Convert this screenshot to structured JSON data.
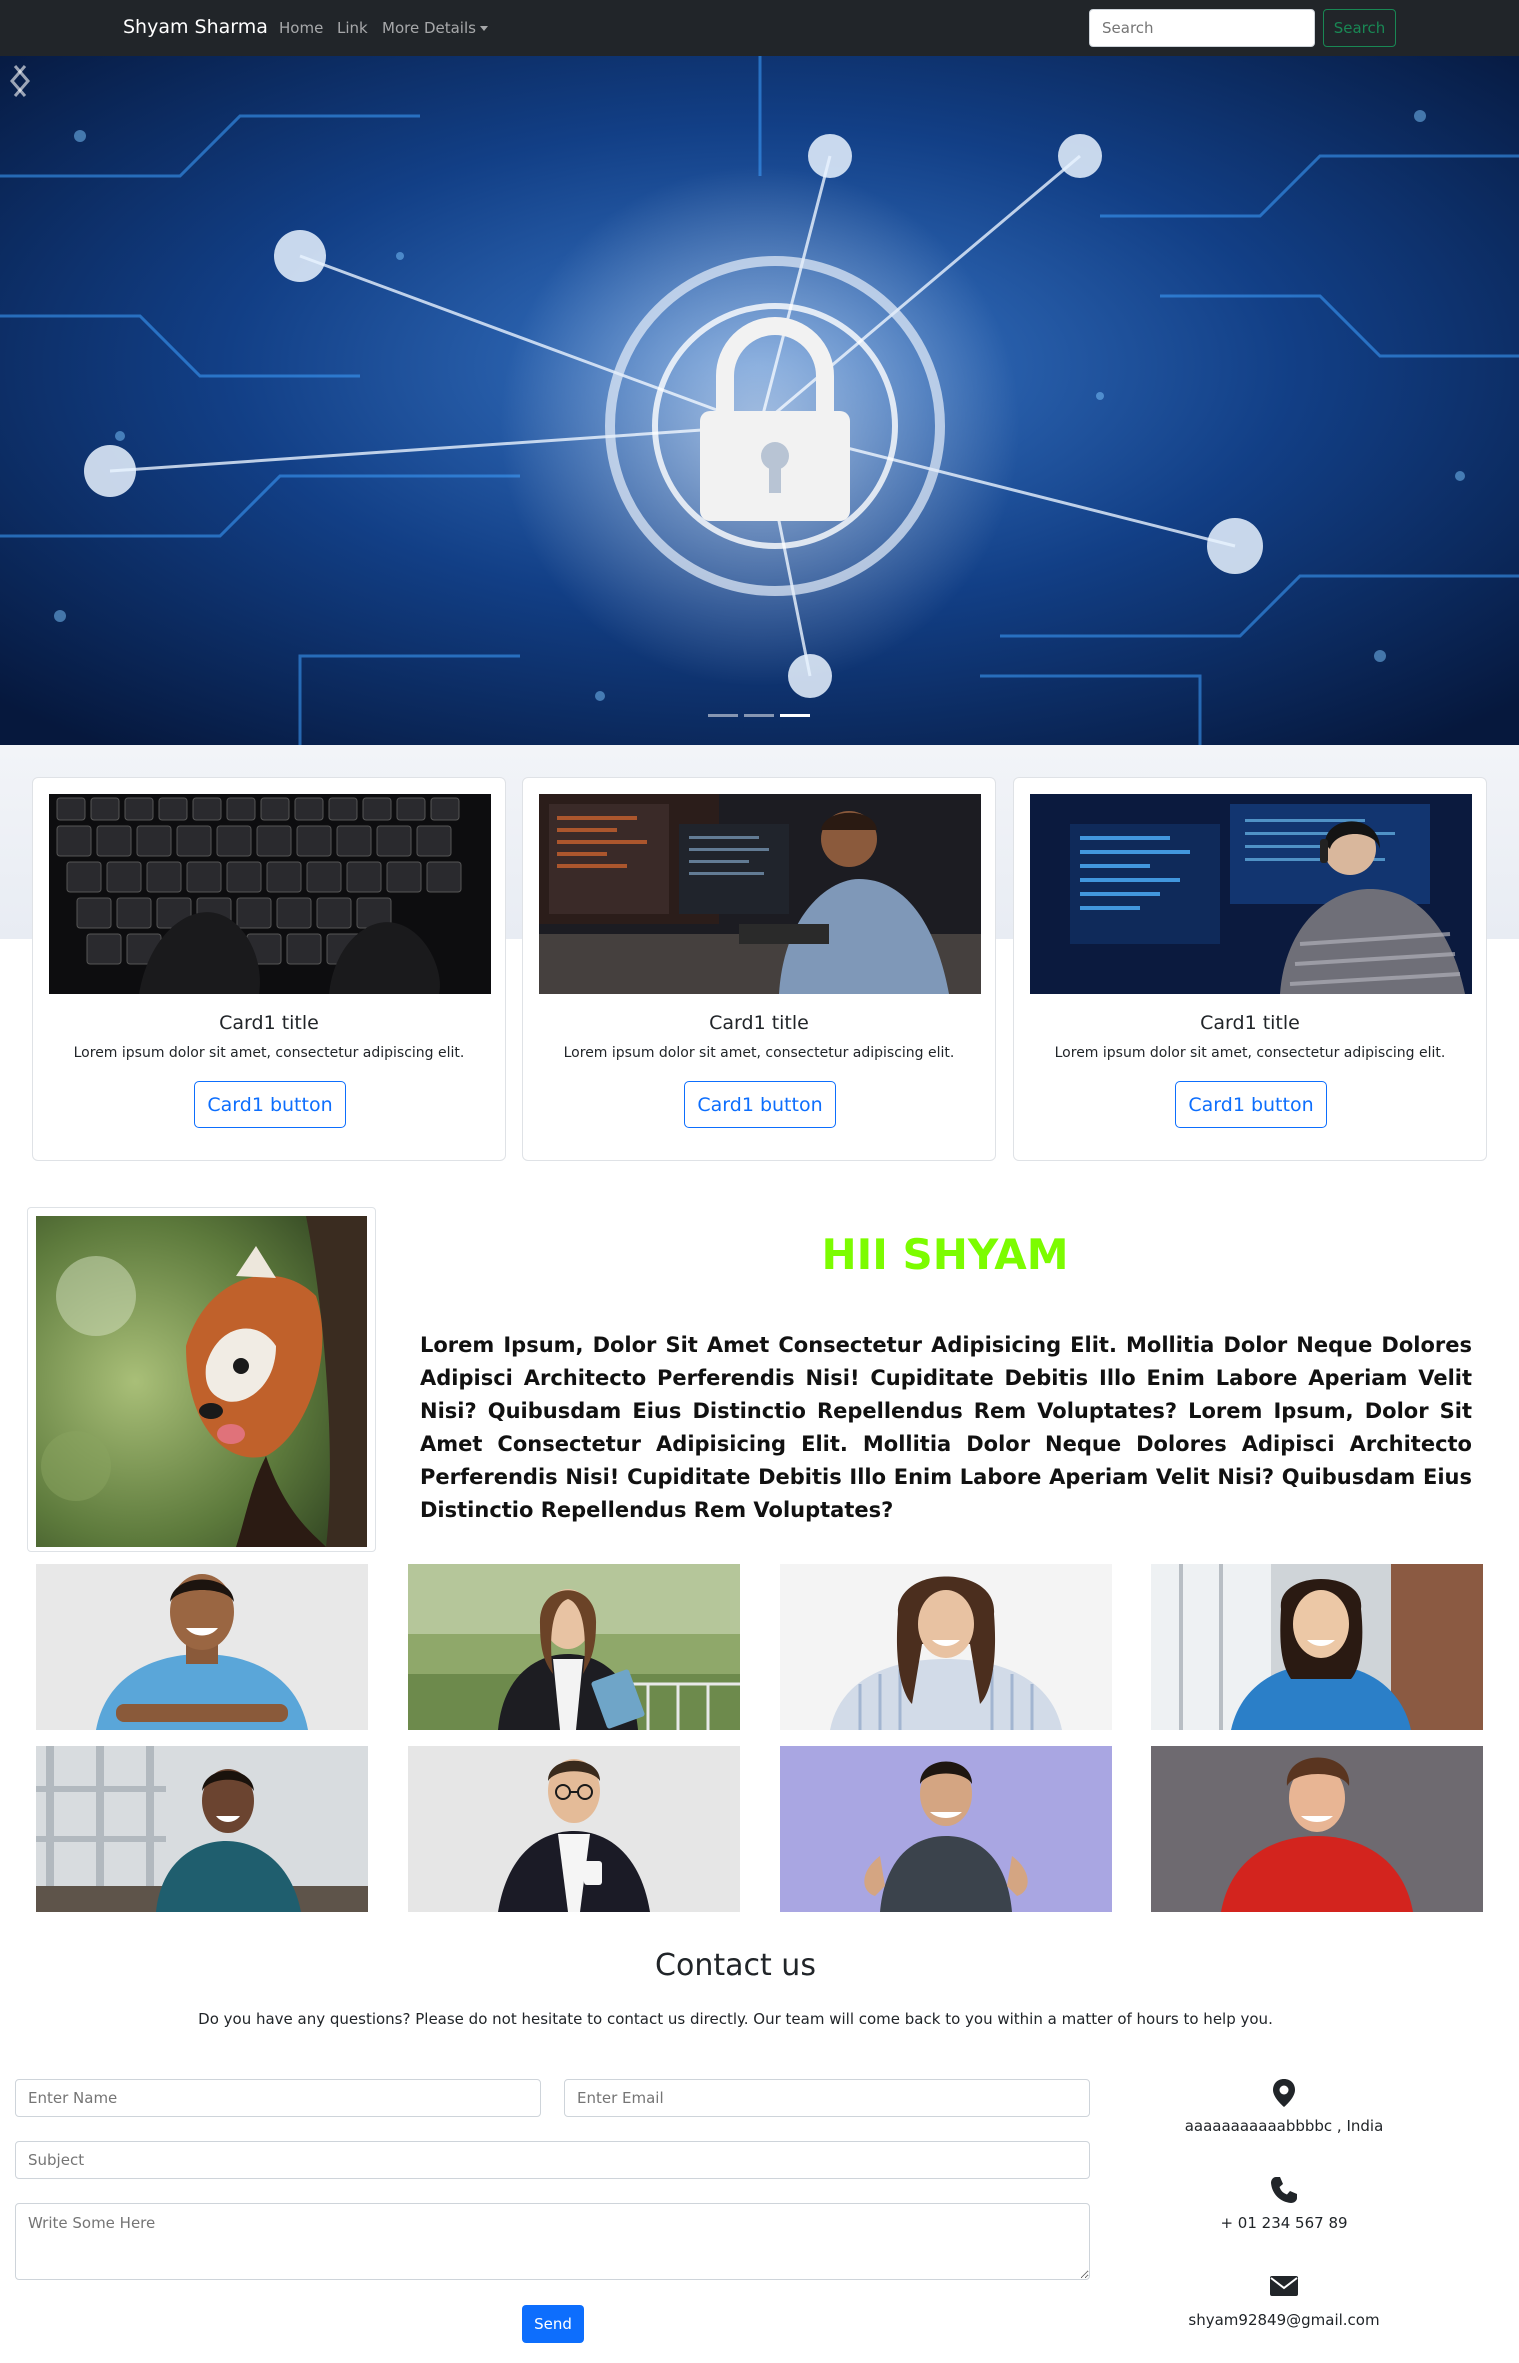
{
  "navbar": {
    "brand": "Shyam Sharma",
    "links": [
      "Home",
      "Link",
      "More Details"
    ],
    "search_placeholder": "Search",
    "search_button": "Search"
  },
  "carousel": {
    "slides": 3,
    "active_index": 2,
    "image": "circuit board with padlock"
  },
  "cards": [
    {
      "title": "Card1 title",
      "text": "Lorem ipsum dolor sit amet, consectetur adipiscing elit.",
      "button": "Card1 button",
      "image": "hand on keyboard"
    },
    {
      "title": "Card1 title",
      "text": "Lorem ipsum dolor sit amet, consectetur adipiscing elit.",
      "button": "Card1 button",
      "image": "man coding at computer"
    },
    {
      "title": "Card1 title",
      "text": "Lorem ipsum dolor sit amet, consectetur adipiscing elit.",
      "button": "Card1 button",
      "image": "woman with headphones coding"
    }
  ],
  "about": {
    "title": "HII SHYAM",
    "text": "Lorem Ipsum, Dolor Sit Amet Consectetur Adipisicing Elit. Mollitia Dolor Neque Dolores Adipisci Architecto Perferendis Nisi! Cupiditate Debitis Illo Enim Labore Aperiam Velit Nisi? Quibusdam Eius Distinctio Repellendus Rem Voluptates? Lorem Ipsum, Dolor Sit Amet Consectetur Adipisicing Elit. Mollitia Dolor Neque Dolores Adipisci Architecto Perferendis Nisi! Cupiditate Debitis Illo Enim Labore Aperiam Velit Nisi? Quibusdam Eius Distinctio Repellendus Rem Voluptates?",
    "image": "red panda"
  },
  "gallery": [
    "man in blue t-shirt",
    "woman in suit with folders",
    "woman in striped shirt",
    "woman in blue top",
    "man in teal sweater",
    "man in suit with coffee",
    "man in grey t-shirt",
    "man in red sweater"
  ],
  "contact": {
    "title": "Contact us",
    "description": "Do you have any questions? Please do not hesitate to contact us directly. Our team will come back to you within a matter of hours to help you.",
    "name_placeholder": "Enter Name",
    "email_placeholder": "Enter Email",
    "subject_placeholder": "Subject",
    "message_placeholder": "Write Some Here",
    "send_button": "Send",
    "address": "aaaaaaaaaaabbbbc , India",
    "phone": "+ 01 234 567 89",
    "email": "shyam92849@gmail.com"
  },
  "colors": {
    "navbar_bg": "#212529",
    "primary": "#0d6efd",
    "success": "#198754",
    "about_title": "#7cfc00"
  }
}
